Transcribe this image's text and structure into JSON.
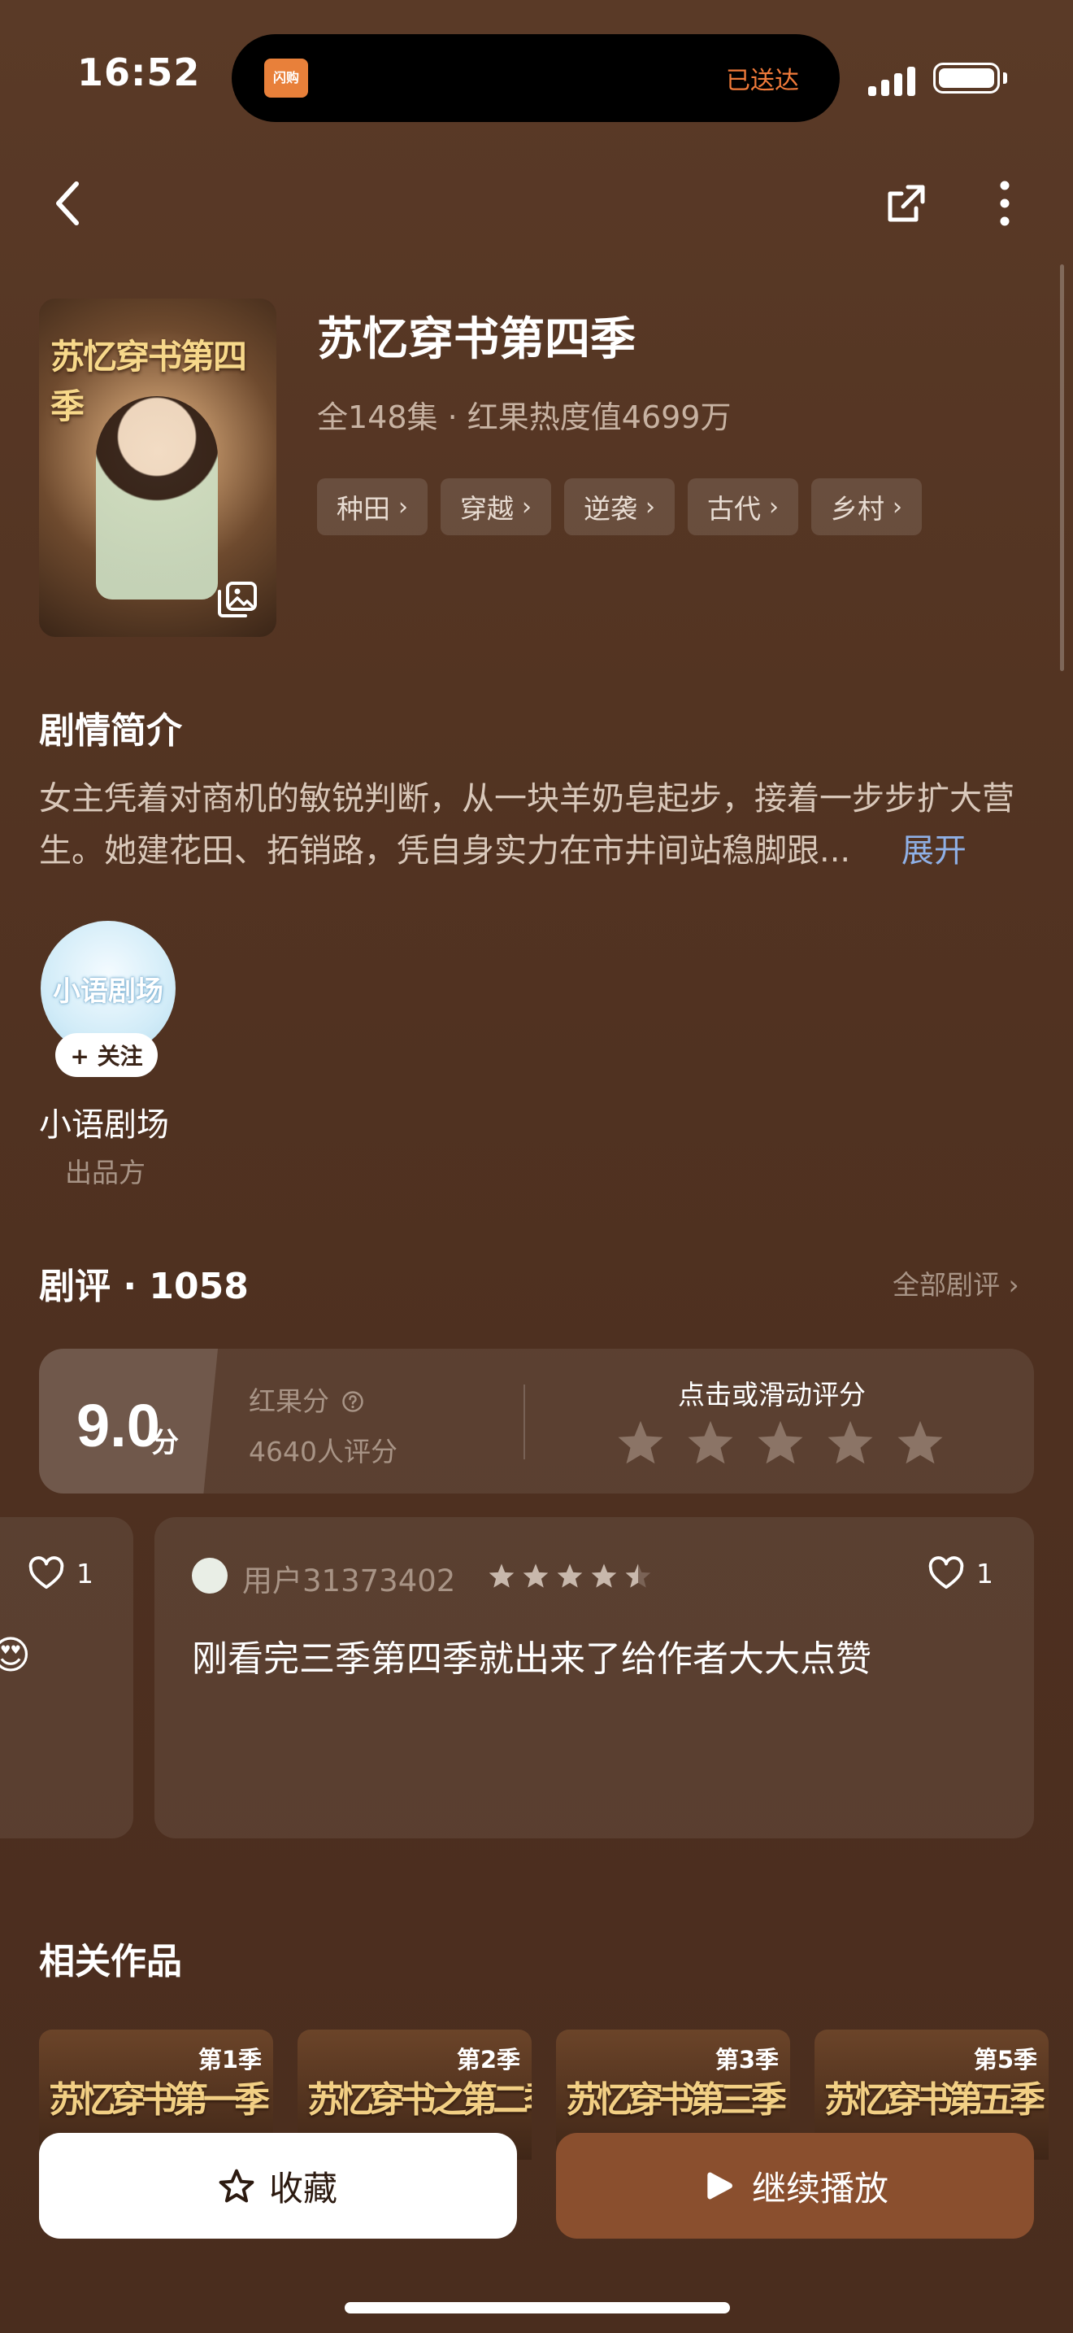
{
  "status_bar": {
    "time": "16:52",
    "island_app_label": "闪购",
    "island_status": "已送达"
  },
  "show": {
    "title": "苏忆穿书第四季",
    "poster_text": "苏忆穿书第四季",
    "meta": "全148集 · 红果热度值4699万",
    "tags": [
      "种田",
      "穿越",
      "逆袭",
      "古代",
      "乡村"
    ]
  },
  "synopsis": {
    "heading": "剧情简介",
    "text": "女主凭着对商机的敏锐判断，从一块羊奶皂起步，接着一步步扩大营生。她建花田、拓销路，凭自身实力在市井间站稳脚跟...",
    "expand_label": "展开"
  },
  "producer": {
    "logo_text": "小语剧场",
    "follow_label": "+ 关注",
    "name": "小语剧场",
    "role": "出品方"
  },
  "reviews": {
    "heading": "剧评 · 1058",
    "all_label": "全部剧评 ›",
    "score": "9.0",
    "score_unit": "分",
    "score_label": "红果分",
    "rating_count": "4640人评分",
    "rate_prompt": "点击或滑动评分",
    "prev_card": {
      "likes": "1",
      "emoji": "😍"
    },
    "card": {
      "user": "用户31373402",
      "stars": 4.5,
      "likes": "1",
      "text": "刚看完三季第四季就出来了给作者大大点赞"
    }
  },
  "related": {
    "heading": "相关作品",
    "items": [
      {
        "season": "第1季",
        "art": "苏忆穿书第一季"
      },
      {
        "season": "第2季",
        "art": "苏忆穿书之第二季"
      },
      {
        "season": "第3季",
        "art": "苏忆穿书第三季"
      },
      {
        "season": "第5季",
        "art": "苏忆穿书第五季"
      }
    ]
  },
  "actions": {
    "favorite_label": "收藏",
    "play_label": "继续播放"
  },
  "colors": {
    "accent_link": "#8fb0e6",
    "play_button": "#8a4f2e",
    "background": "#533422",
    "island_status": "#f07a3a"
  }
}
